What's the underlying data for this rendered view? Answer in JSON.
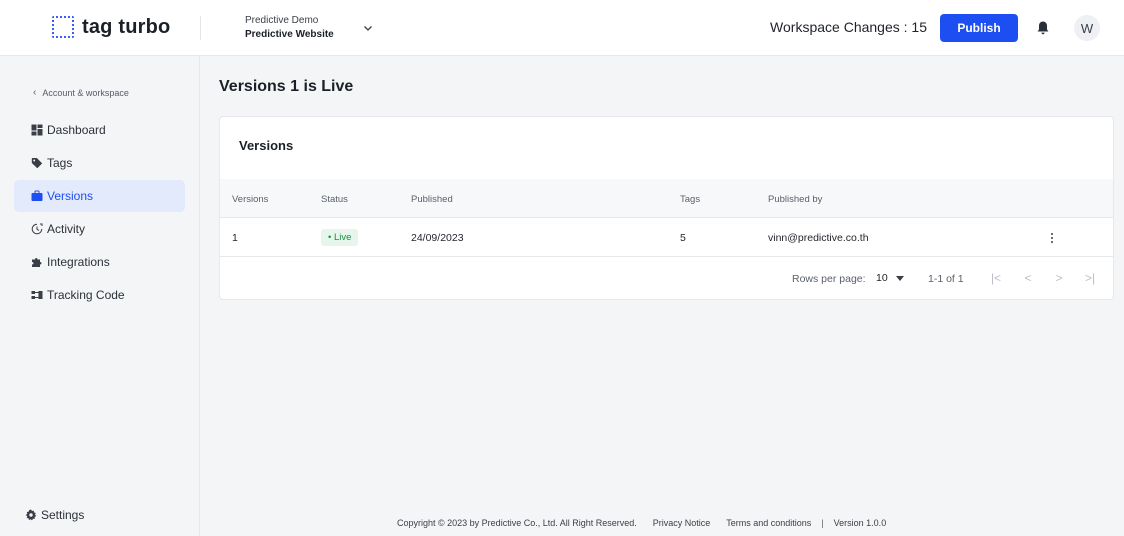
{
  "app": {
    "logo_text": "tag turbo",
    "brand_color": "#1d4ef2"
  },
  "workspace": {
    "org": "Predictive Demo",
    "name": "Predictive Website"
  },
  "header": {
    "changes_label": "Workspace Changes : 15",
    "publish_label": "Publish",
    "avatar_initial": "W"
  },
  "sidebar": {
    "back_label": "Account & workspace",
    "items": [
      {
        "label": "Dashboard",
        "icon": "dashboard-icon",
        "active": false
      },
      {
        "label": "Tags",
        "icon": "tag-icon",
        "active": false
      },
      {
        "label": "Versions",
        "icon": "briefcase-icon",
        "active": true
      },
      {
        "label": "Activity",
        "icon": "activity-icon",
        "active": false
      },
      {
        "label": "Integrations",
        "icon": "puzzle-icon",
        "active": false
      },
      {
        "label": "Tracking Code",
        "icon": "tracking-code-icon",
        "active": false
      }
    ],
    "settings_label": "Settings"
  },
  "main": {
    "title": "Versions 1 is Live",
    "card_title": "Versions",
    "columns": [
      "Versions",
      "Status",
      "Published",
      "Tags",
      "Published by"
    ],
    "rows": [
      {
        "version": "1",
        "status": "Live",
        "published": "24/09/2023",
        "tags": "5",
        "published_by": "vinn@predictive.co.th"
      }
    ],
    "pagination": {
      "rows_per_page_label": "Rows per page:",
      "rows_per_page": "10",
      "range": "1-1 of 1"
    }
  },
  "footer": {
    "copyright": "Copyright © 2023 by Predictive Co., Ltd. All Right Reserved.",
    "privacy": "Privacy Notice",
    "terms": "Terms and conditions",
    "separator": "|",
    "version": "Version 1.0.0"
  }
}
